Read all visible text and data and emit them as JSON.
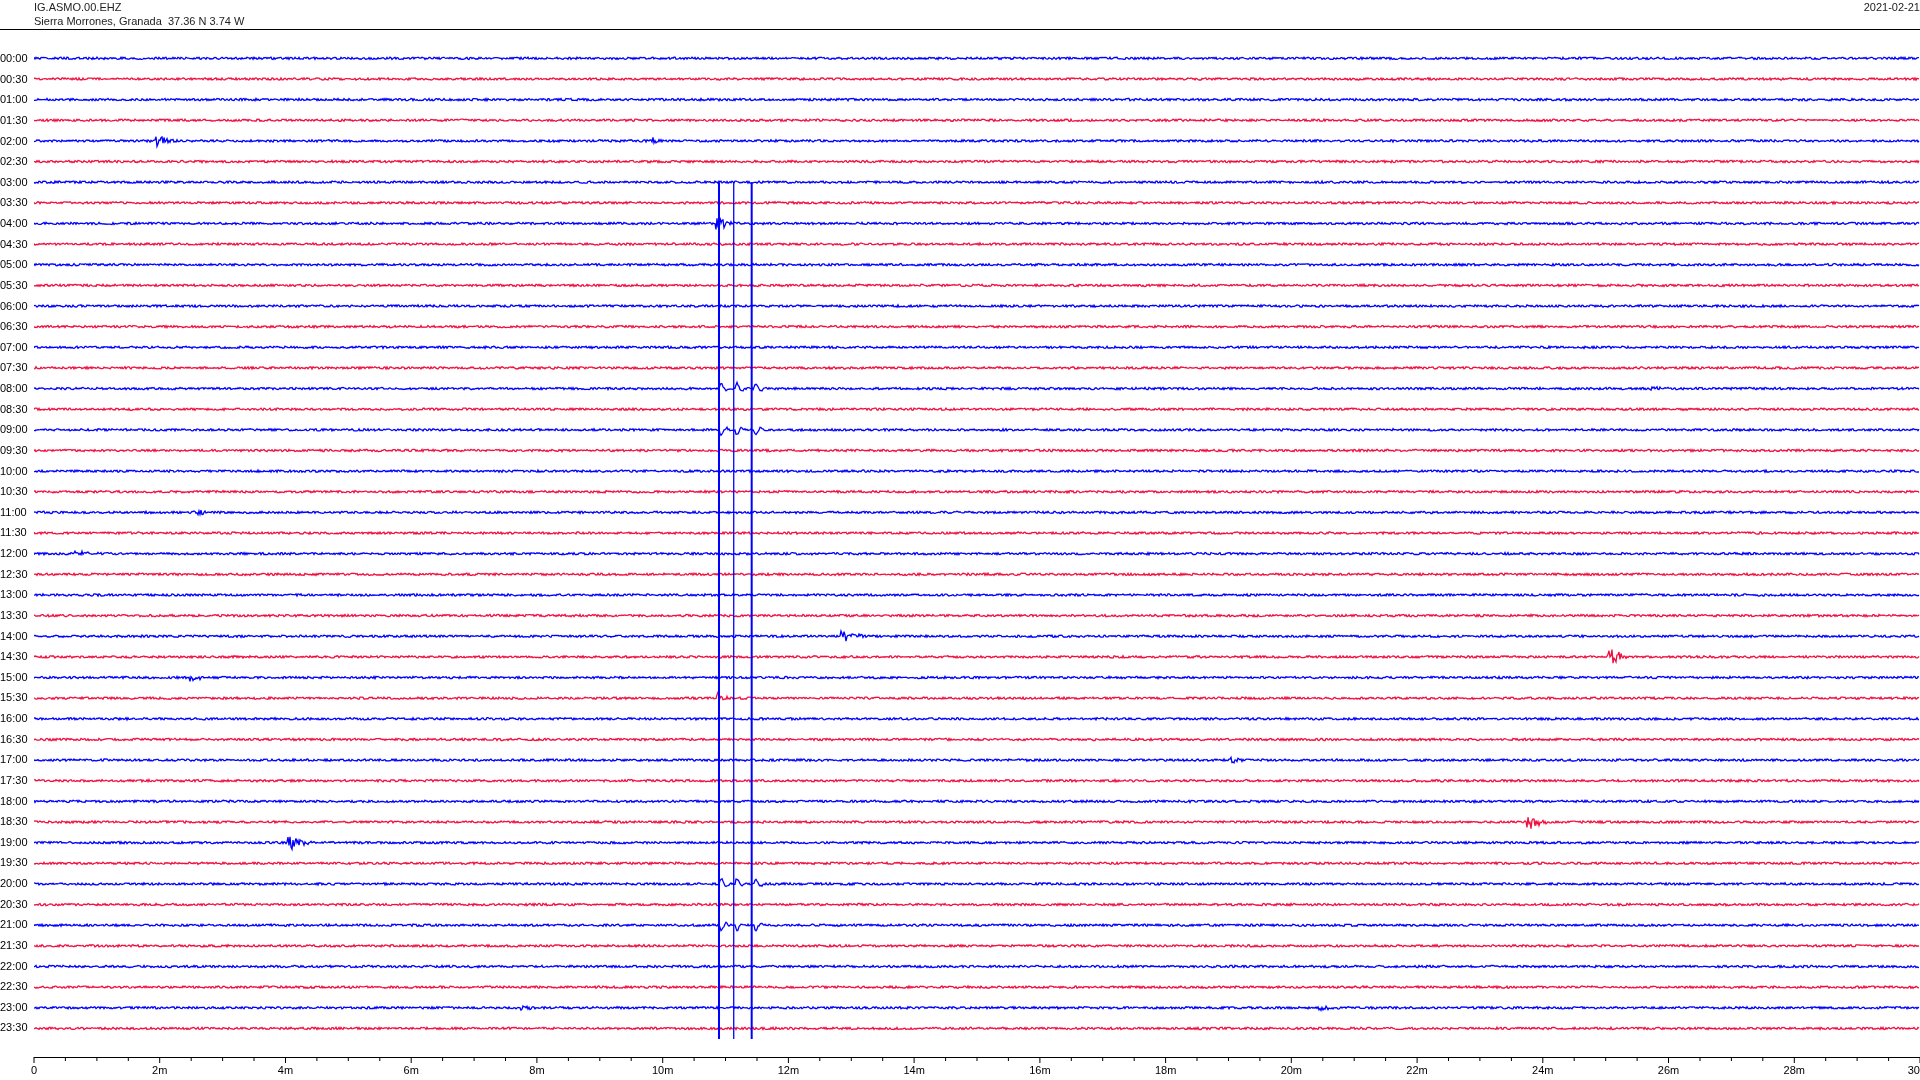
{
  "header": {
    "station": "IG.ASMO.00.EHZ",
    "location": "Sierra Morrones, Granada  37.36 N 3.74 W",
    "date": "2021-02-21"
  },
  "rows": [
    {
      "time": "00:00",
      "color": "#0000ff"
    },
    {
      "time": "00:30",
      "color": "#f01040"
    },
    {
      "time": "01:00",
      "color": "#0000ff"
    },
    {
      "time": "01:30",
      "color": "#f01040"
    },
    {
      "time": "02:00",
      "color": "#0000ff"
    },
    {
      "time": "02:30",
      "color": "#f01040"
    },
    {
      "time": "03:00",
      "color": "#0000ff"
    },
    {
      "time": "03:30",
      "color": "#f01040"
    },
    {
      "time": "04:00",
      "color": "#0000ff"
    },
    {
      "time": "04:30",
      "color": "#f01040"
    },
    {
      "time": "05:00",
      "color": "#0000ff"
    },
    {
      "time": "05:30",
      "color": "#f01040"
    },
    {
      "time": "06:00",
      "color": "#0000ff"
    },
    {
      "time": "06:30",
      "color": "#f01040"
    },
    {
      "time": "07:00",
      "color": "#0000ff"
    },
    {
      "time": "07:30",
      "color": "#f01040"
    },
    {
      "time": "08:00",
      "color": "#0000ff"
    },
    {
      "time": "08:30",
      "color": "#f01040"
    },
    {
      "time": "09:00",
      "color": "#0000ff"
    },
    {
      "time": "09:30",
      "color": "#f01040"
    },
    {
      "time": "10:00",
      "color": "#0000ff"
    },
    {
      "time": "10:30",
      "color": "#f01040"
    },
    {
      "time": "11:00",
      "color": "#0000ff"
    },
    {
      "time": "11:30",
      "color": "#f01040"
    },
    {
      "time": "12:00",
      "color": "#0000ff"
    },
    {
      "time": "12:30",
      "color": "#f01040"
    },
    {
      "time": "13:00",
      "color": "#0000ff"
    },
    {
      "time": "13:30",
      "color": "#f01040"
    },
    {
      "time": "14:00",
      "color": "#0000ff"
    },
    {
      "time": "14:30",
      "color": "#f01040"
    },
    {
      "time": "15:00",
      "color": "#0000ff"
    },
    {
      "time": "15:30",
      "color": "#f01040"
    },
    {
      "time": "16:00",
      "color": "#0000ff"
    },
    {
      "time": "16:30",
      "color": "#f01040"
    },
    {
      "time": "17:00",
      "color": "#0000ff"
    },
    {
      "time": "17:30",
      "color": "#f01040"
    },
    {
      "time": "18:00",
      "color": "#0000ff"
    },
    {
      "time": "18:30",
      "color": "#f01040"
    },
    {
      "time": "19:00",
      "color": "#0000ff"
    },
    {
      "time": "19:30",
      "color": "#f01040"
    },
    {
      "time": "20:00",
      "color": "#0000ff"
    },
    {
      "time": "20:30",
      "color": "#f01040"
    },
    {
      "time": "21:00",
      "color": "#0000ff"
    },
    {
      "time": "21:30",
      "color": "#f01040"
    },
    {
      "time": "22:00",
      "color": "#0000ff"
    },
    {
      "time": "22:30",
      "color": "#f01040"
    },
    {
      "time": "23:00",
      "color": "#0000ff"
    },
    {
      "time": "23:30",
      "color": "#f01040"
    }
  ],
  "x_axis": {
    "labels": [
      "0",
      "2m",
      "4m",
      "6m",
      "8m",
      "10m",
      "12m",
      "14m",
      "16m",
      "18m",
      "20m",
      "22m",
      "24m",
      "26m",
      "28m",
      "30"
    ]
  }
}
